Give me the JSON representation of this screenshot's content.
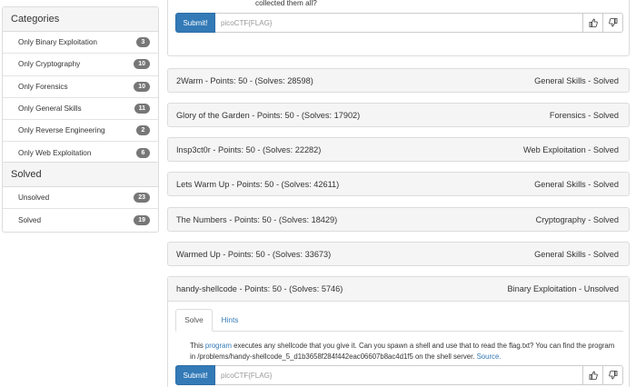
{
  "sidebar": {
    "categories_title": "Categories",
    "categories": [
      {
        "label": "Only Binary Exploitation",
        "count": "3"
      },
      {
        "label": "Only Cryptography",
        "count": "10"
      },
      {
        "label": "Only Forensics",
        "count": "10"
      },
      {
        "label": "Only General Skills",
        "count": "11"
      },
      {
        "label": "Only Reverse Engineering",
        "count": "2"
      },
      {
        "label": "Only Web Exploitation",
        "count": "6"
      }
    ],
    "solved_title": "Solved",
    "solved": [
      {
        "label": "Unsolved",
        "count": "23"
      },
      {
        "label": "Solved",
        "count": "19"
      }
    ]
  },
  "top_problem": {
    "desc_tail": "collected them all?",
    "submit_label": "Submit!",
    "flag_placeholder": "picoCTF{FLAG}"
  },
  "problems": [
    {
      "title": "2Warm - Points: 50 - (Solves: 28598)",
      "status": "General Skills - Solved"
    },
    {
      "title": "Glory of the Garden - Points: 50 - (Solves: 17902)",
      "status": "Forensics - Solved"
    },
    {
      "title": "Insp3ct0r - Points: 50 - (Solves: 22282)",
      "status": "Web Exploitation - Solved"
    },
    {
      "title": "Lets Warm Up - Points: 50 - (Solves: 42611)",
      "status": "General Skills - Solved"
    },
    {
      "title": "The Numbers - Points: 50 - (Solves: 18429)",
      "status": "Cryptography - Solved"
    },
    {
      "title": "Warmed Up - Points: 50 - (Solves: 33673)",
      "status": "General Skills - Solved"
    }
  ],
  "open_problem": {
    "title": "handy-shellcode - Points: 50 - (Solves: 5746)",
    "status": "Binary Exploitation - Unsolved",
    "tab_solve": "Solve",
    "tab_hints": "Hints",
    "desc_1": "This ",
    "desc_link": "program",
    "desc_2": " executes any shellcode that you give it. Can you spawn a shell and use that to read the flag.txt? You can find the program in /problems/handy-shellcode_5_d1b3658f284f442eac06607b8ac4d1f5 on the shell server. ",
    "desc_source": "Source.",
    "submit_label": "Submit!",
    "flag_placeholder": "picoCTF{FLAG}"
  },
  "icons": {
    "thumbs_up": "thumbs-up-icon",
    "thumbs_down": "thumbs-down-icon"
  },
  "colors": {
    "primary": "#337ab7",
    "badge": "#777777",
    "panel_head": "#f5f5f5"
  }
}
